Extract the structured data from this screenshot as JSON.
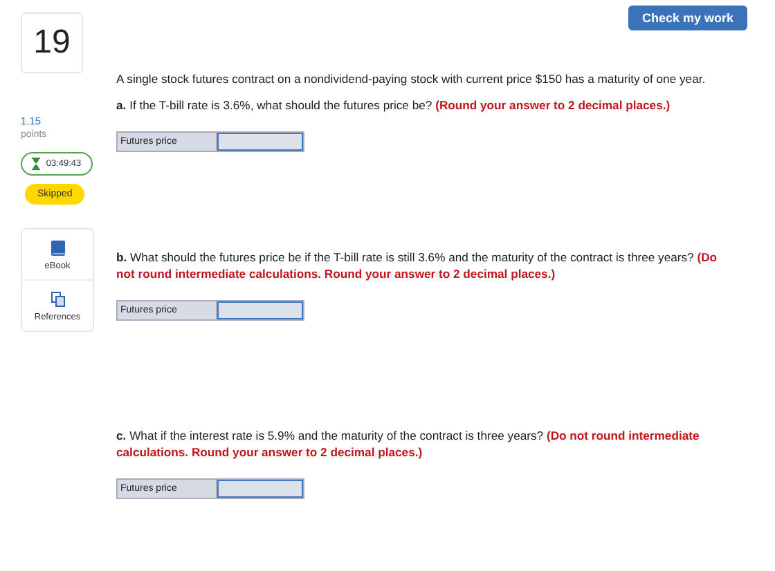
{
  "header": {
    "check_button": "Check my work"
  },
  "sidebar": {
    "question_number": "19",
    "points_value": "1.15",
    "points_label": "points",
    "timer": "03:49:43",
    "status": "Skipped",
    "resources": [
      "eBook",
      "References"
    ]
  },
  "intro": "A single stock futures contract on a nondividend-paying stock with current price $150 has a maturity of one year.",
  "parts": [
    {
      "label": "a.",
      "question": "If the T-bill rate is 3.6%, what should the futures price be?",
      "instruction": "(Round your answer to 2 decimal places.)",
      "field_label": "Futures price"
    },
    {
      "label": "b.",
      "question": "What should the futures price be if the T-bill rate is still 3.6% and the maturity of the contract is three years?",
      "instruction": "(Do not round intermediate calculations. Round your answer to 2 decimal places.)",
      "field_label": "Futures price"
    },
    {
      "label": "c.",
      "question": "What if the interest rate is 5.9% and the maturity of the contract is three years?",
      "instruction": "(Do not round intermediate calculations. Round your answer to 2 decimal places.)",
      "field_label": "Futures price"
    }
  ]
}
